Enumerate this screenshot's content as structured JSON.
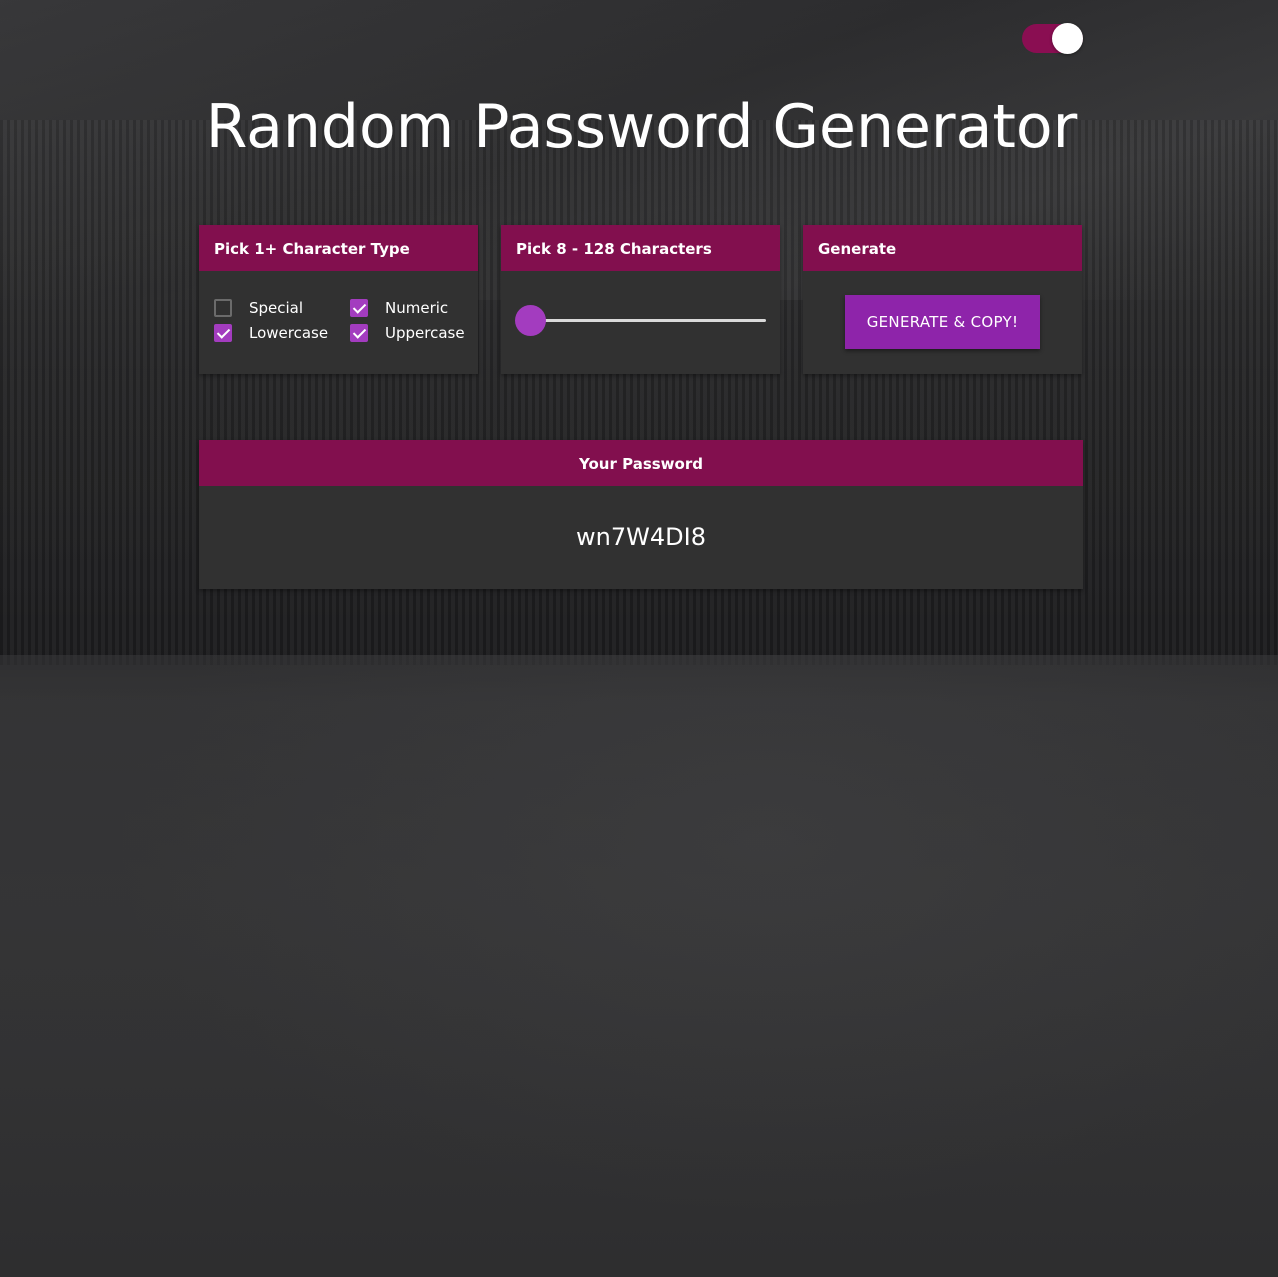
{
  "theme": {
    "accent": "#820f4e",
    "primary": "#a33cbf",
    "button": "#8e24aa",
    "card": "#313131"
  },
  "toggle": {
    "icon": "theme-toggle-icon",
    "state": "on"
  },
  "title": "Random Password Generator",
  "character_types": {
    "header": "Pick 1+ Character Type",
    "options": [
      {
        "label": "Special",
        "checked": false
      },
      {
        "label": "Numeric",
        "checked": true
      },
      {
        "label": "Lowercase",
        "checked": true
      },
      {
        "label": "Uppercase",
        "checked": true
      }
    ]
  },
  "length": {
    "header": "Pick 8 - 128 Characters",
    "min": 8,
    "max": 128,
    "value": 8
  },
  "generate": {
    "header": "Generate",
    "button_label": "GENERATE & COPY!"
  },
  "result": {
    "header": "Your Password",
    "password": "wn7W4DI8"
  }
}
